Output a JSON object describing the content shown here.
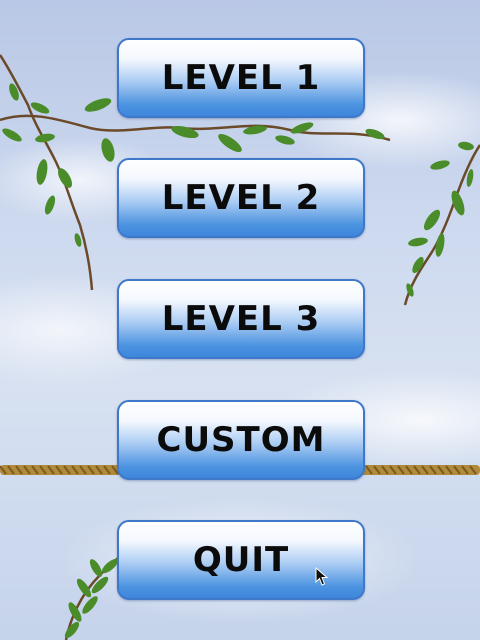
{
  "menu": {
    "items": [
      {
        "label": "LEVEL 1"
      },
      {
        "label": "LEVEL 2"
      },
      {
        "label": "LEVEL 3"
      },
      {
        "label": "CUSTOM"
      },
      {
        "label": "QUIT"
      }
    ]
  },
  "colors": {
    "button_border": "#3f77c9",
    "button_bottom": "#3d86db",
    "sky": "#cdd9ef",
    "rope": "#b08a3a",
    "leaf": "#4a8c2a",
    "branch": "#6b4a2a"
  },
  "decorations": [
    "vine-branch",
    "rope",
    "leaf-sprig",
    "pointer-cursor"
  ]
}
